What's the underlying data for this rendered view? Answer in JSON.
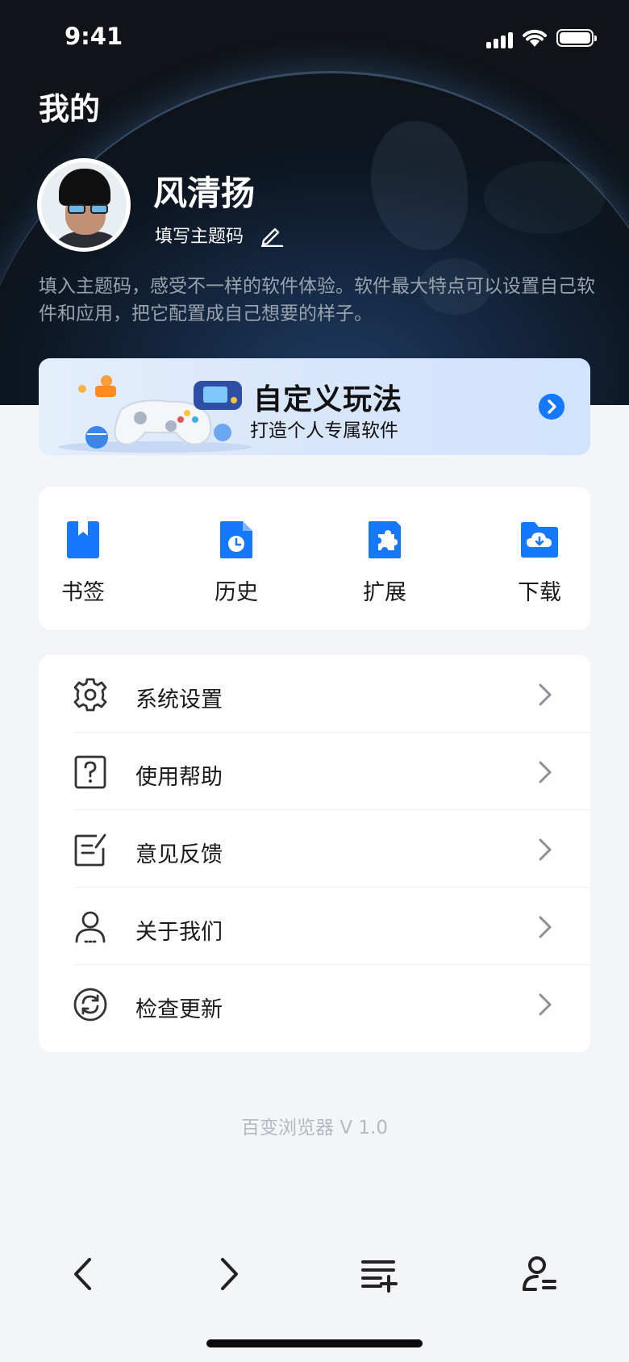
{
  "status_bar": {
    "time": "9:41"
  },
  "header": {
    "title": "我的"
  },
  "profile": {
    "name": "风清扬",
    "theme_code_label": "填写主题码",
    "description": "填入主题码，感受不一样的软件体验。软件最大特点可以设置自己软件和应用，把它配置成自己想要的样子。"
  },
  "banner": {
    "title": "自定义玩法",
    "subtitle": "打造个人专属软件"
  },
  "quick_actions": [
    {
      "label": "书签",
      "icon": "bookmark-icon"
    },
    {
      "label": "历史",
      "icon": "history-icon"
    },
    {
      "label": "扩展",
      "icon": "extension-icon"
    },
    {
      "label": "下载",
      "icon": "download-icon"
    }
  ],
  "menu": [
    {
      "label": "系统设置",
      "icon": "gear-icon"
    },
    {
      "label": "使用帮助",
      "icon": "help-icon"
    },
    {
      "label": "意见反馈",
      "icon": "feedback-icon"
    },
    {
      "label": "关于我们",
      "icon": "user-icon"
    },
    {
      "label": "检查更新",
      "icon": "refresh-icon"
    }
  ],
  "footer": {
    "version": "百变浏览器 V 1.0"
  },
  "tab_bar": [
    "back-icon",
    "forward-icon",
    "menu-add-icon",
    "profile-icon"
  ],
  "colors": {
    "accent": "#1677ff",
    "hero_bg": "#0d1520",
    "page_bg": "#f4f5f9"
  }
}
